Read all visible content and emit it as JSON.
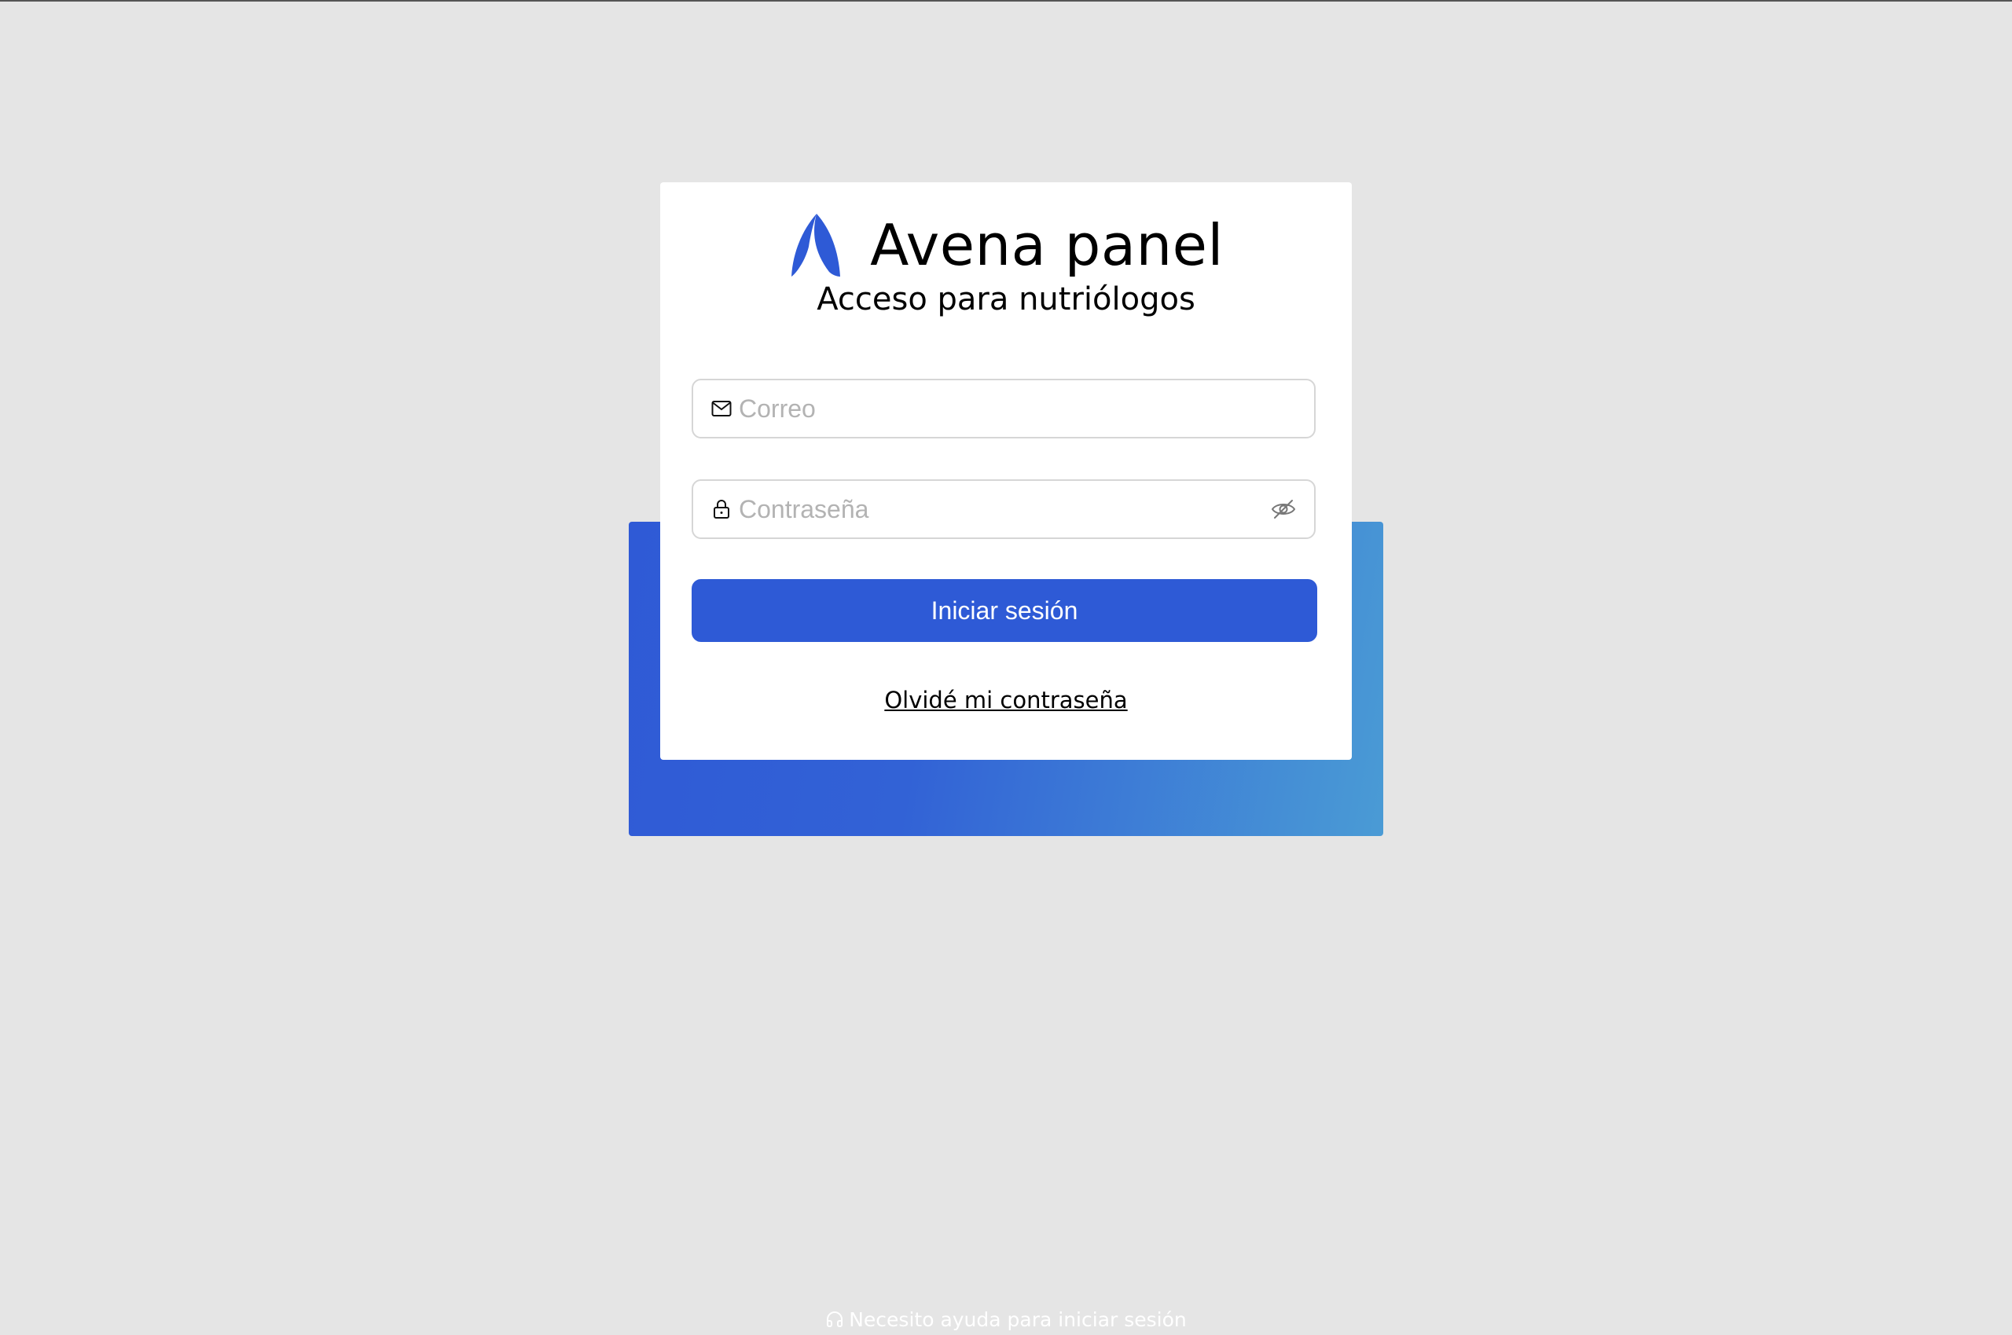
{
  "brand": {
    "name": "Avena panel",
    "logo_icon": "avena-leaf-logo",
    "accent_color": "#2e5ad6"
  },
  "login": {
    "subtitle": "Acceso para nutriólogos",
    "email_placeholder": "Correo",
    "email_icon": "mail-icon",
    "password_placeholder": "Contraseña",
    "password_icon": "lock-icon",
    "password_toggle_icon": "eye-off-icon",
    "submit_label": "Iniciar sesión",
    "forgot_label": "Olvidé mi contraseña"
  },
  "help": {
    "label": "Necesito ayuda para iniciar sesión",
    "icon": "headphones-icon"
  }
}
